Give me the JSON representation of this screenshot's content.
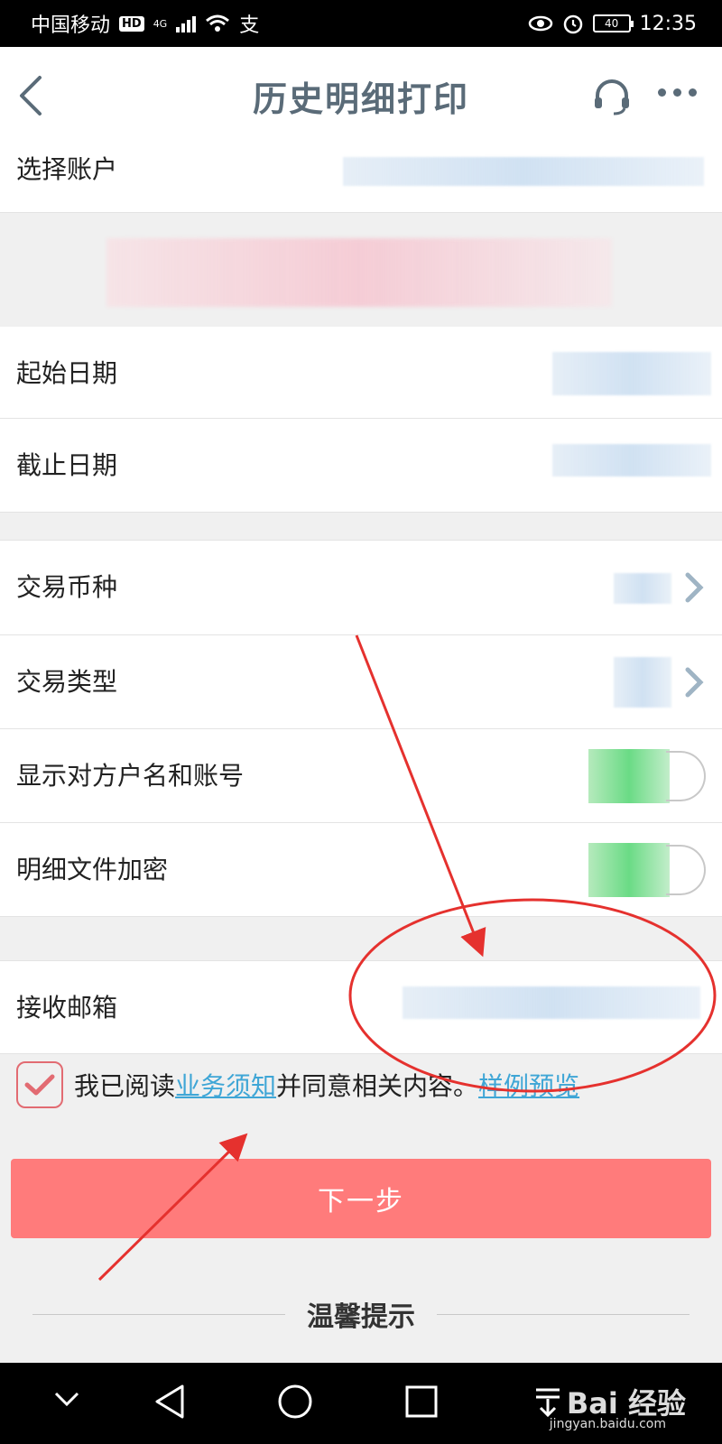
{
  "status_bar": {
    "carrier": "中国移动",
    "hd_badge": "HD",
    "network": "4G",
    "app_icon": "支",
    "battery": "40",
    "time": "12:35"
  },
  "nav": {
    "title": "历史明细打印",
    "back_icon": "chevron-left-icon",
    "service_icon": "headset-icon",
    "more_icon": "more-dots-icon"
  },
  "form": {
    "account_label": "选择账户",
    "start_date_label": "起始日期",
    "end_date_label": "截止日期",
    "currency_label": "交易币种",
    "type_label": "交易类型",
    "show_counterparty_label": "显示对方户名和账号",
    "encrypt_label": "明细文件加密",
    "email_label": "接收邮箱"
  },
  "agreement": {
    "prefix": "我已阅读",
    "notice_link": "业务须知",
    "middle": "并同意相关内容。",
    "sample_link": "样例预览",
    "checked": true
  },
  "next_button": "下一步",
  "tips_title": "温馨提示",
  "watermark": {
    "brand": "Bai 经验",
    "url": "jingyan.baidu.com"
  },
  "colors": {
    "accent": "#ff7b7b",
    "link": "#3fa6d6",
    "title": "#5a6b78",
    "annotation": "#e5312e"
  }
}
